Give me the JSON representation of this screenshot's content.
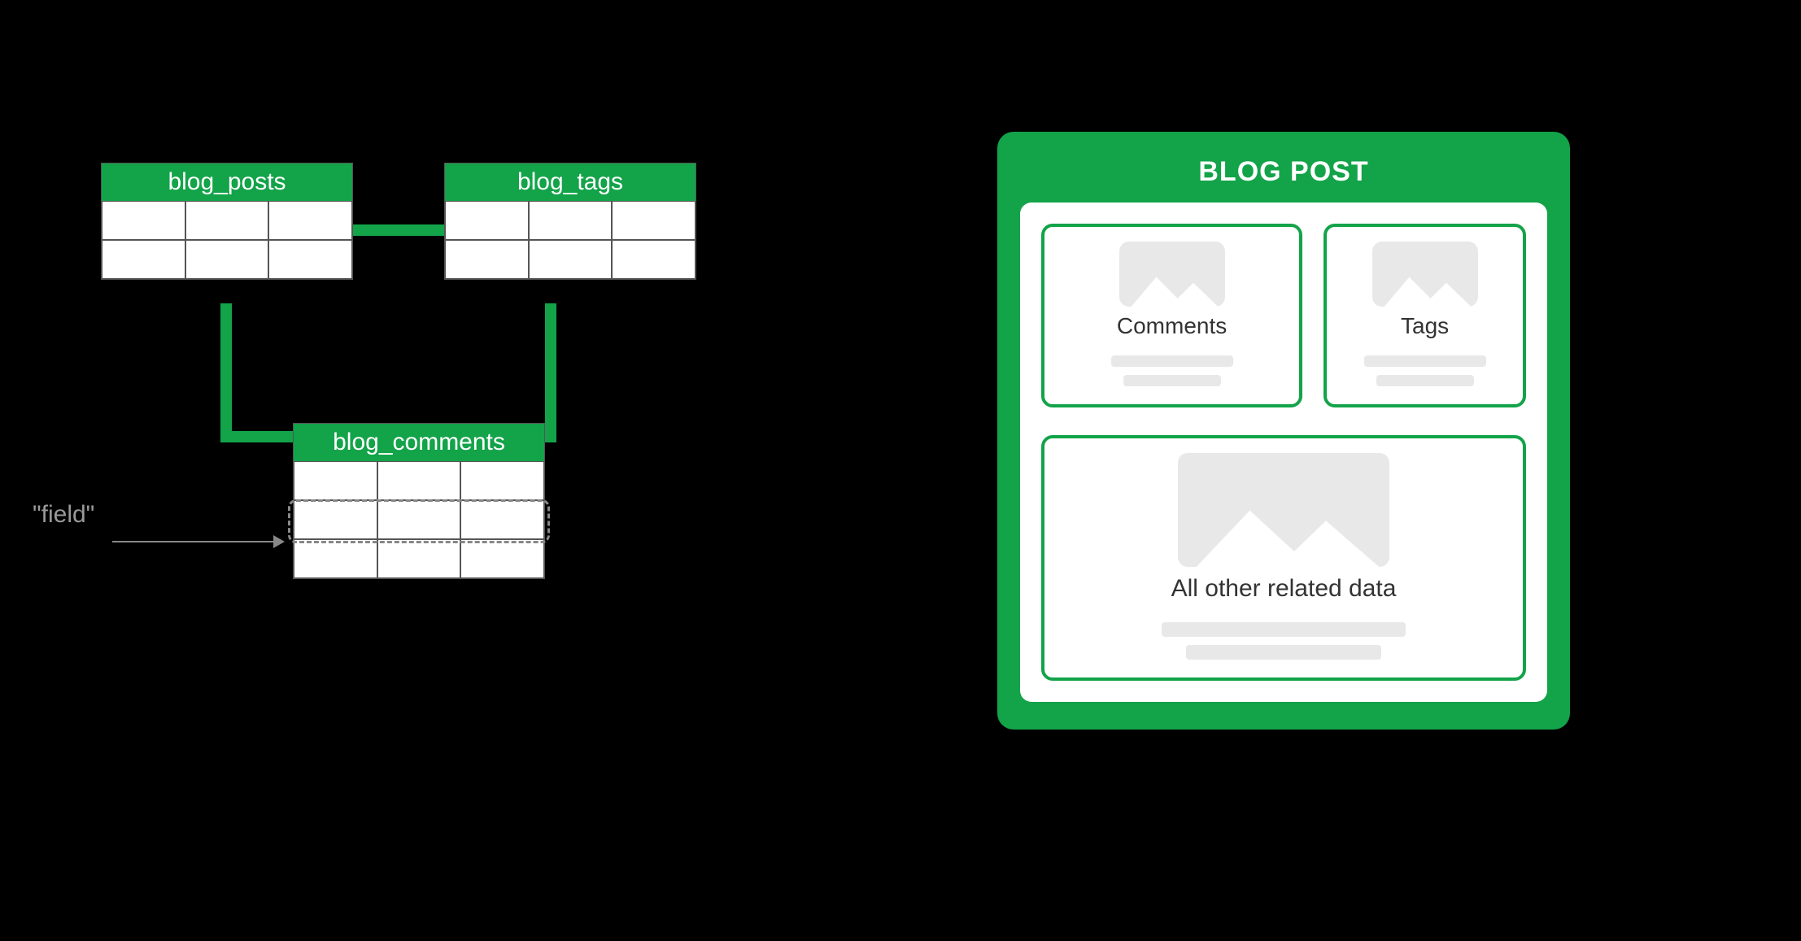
{
  "colors": {
    "accent": "#13a349",
    "muted": "#e8e8e8",
    "text_muted": "#999"
  },
  "relational": {
    "tables": {
      "posts": {
        "label": "blog_posts",
        "rows": 2,
        "cols": 3
      },
      "tags": {
        "label": "blog_tags",
        "rows": 2,
        "cols": 3
      },
      "comments": {
        "label": "blog_comments",
        "rows": 3,
        "cols": 3
      }
    },
    "field_pointer_label": "\"field\""
  },
  "document": {
    "title": "BLOG POST",
    "cards": {
      "comments": {
        "label": "Comments"
      },
      "tags": {
        "label": "Tags"
      },
      "other": {
        "label": "All other related data"
      }
    }
  }
}
